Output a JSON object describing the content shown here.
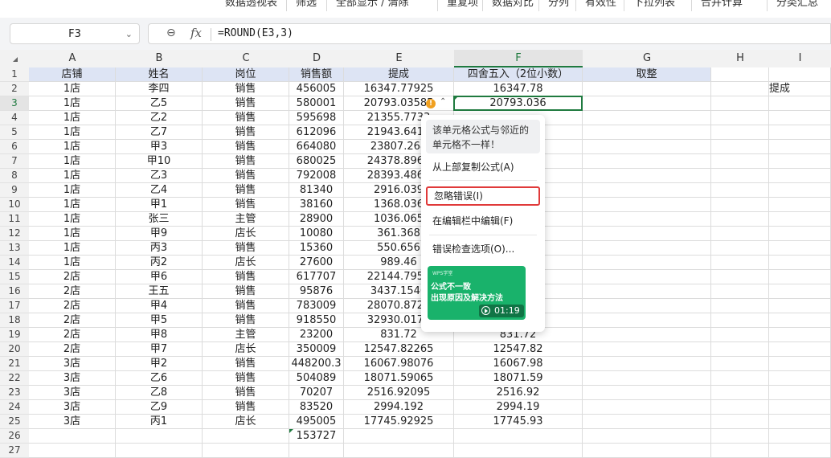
{
  "ribbon": {
    "items": [
      "数据透视表",
      "筛选",
      "全部显示 / 清除",
      "重复项",
      "数据对比",
      "分列",
      "有效性",
      "下拉列表",
      "合并计算",
      "分类汇总"
    ]
  },
  "formula_bar": {
    "name_box": "F3",
    "fx_label": "fx",
    "formula": "=ROUND(E3,3)"
  },
  "columns": [
    "A",
    "B",
    "C",
    "D",
    "E",
    "F",
    "G",
    "H",
    "I"
  ],
  "header_row": [
    "店铺",
    "姓名",
    "岗位",
    "销售额",
    "提成",
    "四舍五入（2位小数）",
    "取整",
    "",
    ""
  ],
  "rows": [
    [
      "1店",
      "李四",
      "销售",
      "456005",
      "16347.77925",
      "16347.78",
      "",
      "",
      "提成"
    ],
    [
      "1店",
      "乙5",
      "销售",
      "580001",
      "20793.03585",
      "20793.036",
      "",
      "",
      ""
    ],
    [
      "1店",
      "乙2",
      "销售",
      "595698",
      "21355.7733",
      "",
      "",
      "",
      ""
    ],
    [
      "1店",
      "乙7",
      "销售",
      "612096",
      "21943.6416",
      "",
      "",
      "",
      ""
    ],
    [
      "1店",
      "甲3",
      "销售",
      "664080",
      "23807.268",
      "",
      "",
      "",
      ""
    ],
    [
      "1店",
      "甲10",
      "销售",
      "680025",
      "24378.8963",
      "",
      "",
      "",
      ""
    ],
    [
      "1店",
      "乙3",
      "销售",
      "792008",
      "28393.4868",
      "",
      "",
      "",
      ""
    ],
    [
      "1店",
      "乙4",
      "销售",
      "81340",
      "2916.039",
      "",
      "",
      "",
      ""
    ],
    [
      "1店",
      "甲1",
      "销售",
      "38160",
      "1368.036",
      "",
      "",
      "",
      ""
    ],
    [
      "1店",
      "张三",
      "主管",
      "28900",
      "1036.065",
      "",
      "",
      "",
      ""
    ],
    [
      "1店",
      "甲9",
      "店长",
      "10080",
      "361.368",
      "",
      "",
      "",
      ""
    ],
    [
      "1店",
      "丙3",
      "销售",
      "15360",
      "550.656",
      "",
      "",
      "",
      ""
    ],
    [
      "1店",
      "丙2",
      "店长",
      "27600",
      "989.46",
      "",
      "",
      "",
      ""
    ],
    [
      "2店",
      "甲6",
      "销售",
      "617707",
      "22144.7959",
      "",
      "",
      "",
      ""
    ],
    [
      "2店",
      "王五",
      "销售",
      "95876",
      "3437.1546",
      "",
      "",
      "",
      ""
    ],
    [
      "2店",
      "甲4",
      "销售",
      "783009",
      "28070.8726",
      "",
      "",
      "",
      ""
    ],
    [
      "2店",
      "甲5",
      "销售",
      "918550",
      "32930.0175",
      "",
      "",
      "",
      ""
    ],
    [
      "2店",
      "甲8",
      "主管",
      "23200",
      "831.72",
      "831.72",
      "",
      "",
      ""
    ],
    [
      "2店",
      "甲7",
      "店长",
      "350009",
      "12547.82265",
      "12547.82",
      "",
      "",
      ""
    ],
    [
      "3店",
      "甲2",
      "销售",
      "448200.3",
      "16067.98076",
      "16067.98",
      "",
      "",
      ""
    ],
    [
      "3店",
      "乙6",
      "销售",
      "504089",
      "18071.59065",
      "18071.59",
      "",
      "",
      ""
    ],
    [
      "3店",
      "乙8",
      "销售",
      "70207",
      "2516.92095",
      "2516.92",
      "",
      "",
      ""
    ],
    [
      "3店",
      "乙9",
      "销售",
      "83520",
      "2994.192",
      "2994.19",
      "",
      "",
      ""
    ],
    [
      "3店",
      "丙1",
      "店长",
      "495005",
      "17745.92925",
      "17745.93",
      "",
      "",
      ""
    ],
    [
      "",
      "",
      "",
      "153727",
      "",
      "",
      "",
      "",
      ""
    ],
    [
      "",
      "",
      "",
      "",
      "",
      "",
      "",
      "",
      ""
    ]
  ],
  "popup": {
    "message": "该单元格公式与邻近的单元格不一样！",
    "copy_from_above": "从上部复制公式(A)",
    "ignore_error": "忽略错误(I)",
    "edit_in_formula_bar": "在编辑栏中编辑(F)",
    "error_options": "错误检查选项(O)...",
    "video_brand": "WPS学堂",
    "video_title_1": "公式不一致",
    "video_title_2": "出现原因及解决方法",
    "video_duration": "01:19"
  },
  "colors": {
    "header_fill": "#dde4f4",
    "active": "#1f7a3f",
    "highlight": "#e03a3a",
    "video": "#19b26b"
  }
}
